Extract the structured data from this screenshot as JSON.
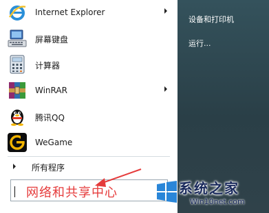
{
  "start_menu": {
    "programs": [
      {
        "label": "Internet Explorer",
        "icon": "internet-explorer-icon",
        "has_submenu": true
      },
      {
        "label": "屏幕键盘",
        "icon": "keyboard-icon",
        "has_submenu": false
      },
      {
        "label": "计算器",
        "icon": "calculator-icon",
        "has_submenu": false
      },
      {
        "label": "WinRAR",
        "icon": "winrar-icon",
        "has_submenu": true
      },
      {
        "label": "腾讯QQ",
        "icon": "qq-penguin-icon",
        "has_submenu": false
      },
      {
        "label": "WeGame",
        "icon": "wegame-icon",
        "has_submenu": false
      }
    ],
    "all_programs_label": "所有程序",
    "search_text": "网络和共享中心",
    "right_items": [
      "设备和打印机",
      "运行..."
    ]
  },
  "watermark": {
    "title": "系统之家",
    "domain": "Win10net.com"
  },
  "colors": {
    "annotation_red": "#e53b3b",
    "right_panel": "#2e434b",
    "watermark_text": "#1a2a5c"
  }
}
